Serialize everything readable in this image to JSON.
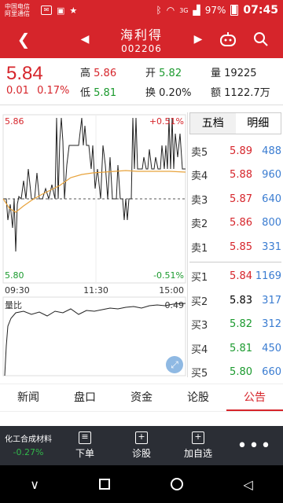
{
  "status": {
    "carrier_line1": "中国电信",
    "carrier_line2": "阿里通信",
    "battery": "97%",
    "time": "07:45",
    "signal_label": "3G"
  },
  "header": {
    "name": "海利得",
    "code": "002206"
  },
  "quote": {
    "price": "5.84",
    "change": "0.01",
    "change_pct": "0.17%",
    "high_label": "高",
    "high": "5.86",
    "low_label": "低",
    "low": "5.81",
    "open_label": "开",
    "open": "5.82",
    "turnover_label": "换",
    "turnover": "0.20%",
    "volume_label": "量",
    "volume": "19225",
    "amount_label": "额",
    "amount": "1122.7万"
  },
  "chart": {
    "top_price": "5.86",
    "bottom_price": "5.80",
    "top_pct": "+0.51%",
    "bottom_pct": "-0.51%",
    "time_start": "09:30",
    "time_mid": "11:30",
    "time_end": "15:00",
    "ratio_label": "量比",
    "ratio_value": "0.49"
  },
  "order_book": {
    "tab_five": "五档",
    "tab_detail": "明细",
    "asks": [
      {
        "label": "卖5",
        "price": "5.89",
        "vol": "488"
      },
      {
        "label": "卖4",
        "price": "5.88",
        "vol": "960"
      },
      {
        "label": "卖3",
        "price": "5.87",
        "vol": "640"
      },
      {
        "label": "卖2",
        "price": "5.86",
        "vol": "800"
      },
      {
        "label": "卖1",
        "price": "5.85",
        "vol": "331"
      }
    ],
    "bids": [
      {
        "label": "买1",
        "price": "5.84",
        "vol": "1169"
      },
      {
        "label": "买2",
        "price": "5.83",
        "vol": "317"
      },
      {
        "label": "买3",
        "price": "5.82",
        "vol": "312"
      },
      {
        "label": "买4",
        "price": "5.81",
        "vol": "450"
      },
      {
        "label": "买5",
        "price": "5.80",
        "vol": "660"
      }
    ]
  },
  "tabs": [
    "新闻",
    "盘口",
    "资金",
    "论股",
    "公告"
  ],
  "toolbar": {
    "sector": "化工合成材料",
    "sector_pct": "-0.27%",
    "order": "下单",
    "diagnose": "诊股",
    "add": "加自选"
  },
  "colors": {
    "accent": "#d6252b",
    "up": "#d6252b",
    "down": "#1b9a2e",
    "avg_line": "#e8a33c"
  }
}
